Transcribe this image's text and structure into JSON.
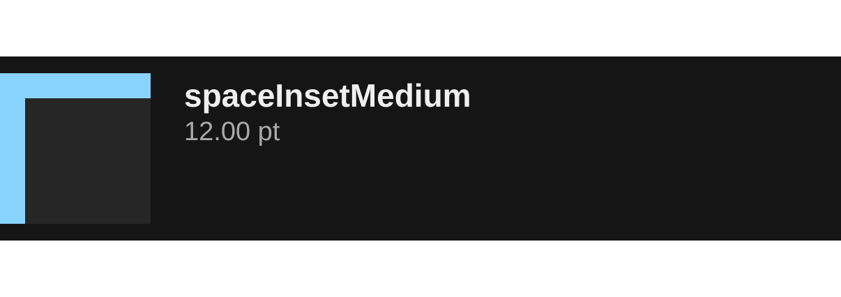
{
  "token": {
    "name": "spaceInsetMedium",
    "value": "12.00 pt",
    "value_points": 12
  },
  "colors": {
    "inset_highlight": "#89d3ff",
    "content_fill": "#262626",
    "row_background": "#151515"
  }
}
